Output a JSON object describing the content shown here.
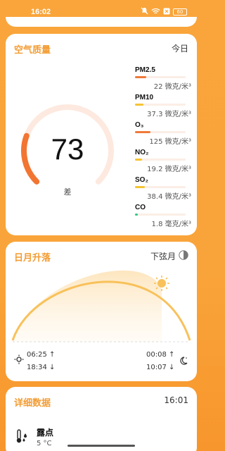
{
  "status_bar": {
    "time": "16:02",
    "battery": "60"
  },
  "aqi": {
    "title": "空气质量",
    "period": "今日",
    "value": "73",
    "level": "差",
    "pollutants": [
      {
        "name": "PM2.5",
        "value": "22 微克/米³",
        "fill": 0.22,
        "color": "#f07a3a"
      },
      {
        "name": "PM10",
        "value": "37.3 微克/米³",
        "fill": 0.16,
        "color": "#f5c432"
      },
      {
        "name": "O₃",
        "value": "125 微克/米³",
        "fill": 0.3,
        "color": "#f07a3a"
      },
      {
        "name": "NO₂",
        "value": "19.2 微克/米³",
        "fill": 0.14,
        "color": "#f5c432"
      },
      {
        "name": "SO₂",
        "value": "38.4 微克/米³",
        "fill": 0.2,
        "color": "#f5c432"
      },
      {
        "name": "CO",
        "value": "1.8 毫克/米³",
        "fill": 0.06,
        "color": "#2fc98b"
      }
    ]
  },
  "sun_moon": {
    "title": "日月升落",
    "moon_phase": "下弦月",
    "sunrise": "06:25",
    "sunset": "18:34",
    "moonrise": "00:08",
    "moonset": "10:07"
  },
  "detail": {
    "title": "详细数据",
    "time": "16:01",
    "dew_point_label": "露点",
    "dew_point_value": "5 °C"
  },
  "colors": {
    "accent": "#f39c33",
    "gauge_track": "#fde9df",
    "gauge_fill": "#f27532"
  }
}
